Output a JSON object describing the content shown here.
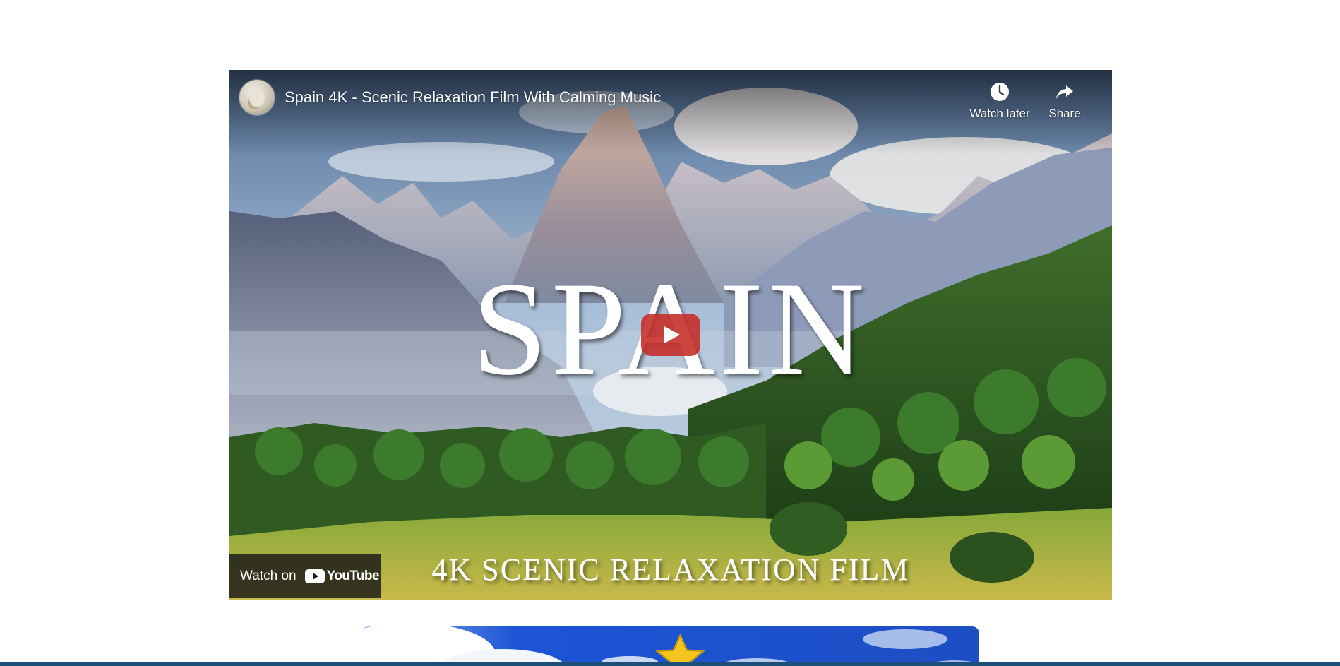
{
  "video": {
    "channel_avatar": "channel-avatar-bird",
    "title": "Spain 4K - Scenic Relaxation Film With Calming Music",
    "watch_later_label": "Watch later",
    "share_label": "Share",
    "watch_on_label": "Watch on",
    "youtube_wordmark": "YouTube",
    "thumbnail_headline": "SPAIN",
    "thumbnail_subline": "4K SCENIC RELAXATION FILM",
    "play_button_color": "#c4302b",
    "icons": {
      "watch_later": "clock-icon",
      "share": "share-arrow-icon",
      "play": "play-icon",
      "youtube": "youtube-logo-icon"
    }
  },
  "next_card": {
    "badge_icon": "star-icon",
    "badge_color": "#f4c51e"
  },
  "colors": {
    "page_background": "#ffffff",
    "bottom_strip": "#1d4e79"
  }
}
